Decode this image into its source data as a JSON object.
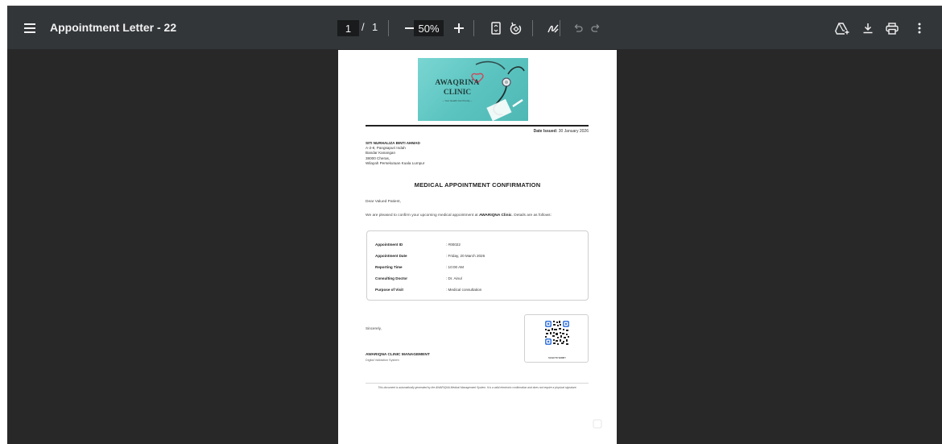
{
  "toolbar": {
    "title": "Appointment Letter - 22",
    "page_current": "1",
    "page_separator": "/",
    "page_total": "1",
    "zoom": "50%",
    "icons": [
      "menu-icon",
      "minus-icon",
      "plus-icon",
      "fit-page-icon",
      "rotate-icon",
      "annotate-icon",
      "undo-icon",
      "redo-icon",
      "drive-icon",
      "download-icon",
      "print-icon",
      "more-vert-icon"
    ]
  },
  "letter": {
    "logo": {
      "name": "AWAQRINA",
      "clinic": "CLINIC",
      "tagline": "~ Your Health Our Priority ~"
    },
    "date_label": "Date Issued:",
    "date_value": "30 January 2026",
    "recipient": {
      "name": "SITI NURHALIZA BINTI AHMAD",
      "line1": "A-2-8, Pangsapuri Indah",
      "line2": "Bandar Kanangan",
      "line3": "38000 Cheras,",
      "line4": "Wilayah Persekutuan Kuala Lumpur"
    },
    "heading": "MEDICAL APPOINTMENT CONFIRMATION",
    "salutation": "Dear Valued Patient,",
    "intro_before": "We are pleased to confirm your upcoming medical appointment at ",
    "intro_clinic": "AWARIQNA Clinic",
    "intro_after": ". Details are as follows:",
    "details": [
      {
        "label": "Appointment ID",
        "value": ": #00022"
      },
      {
        "label": "Appointment Date",
        "value": ": Friday, 20 March 2026"
      },
      {
        "label": "Reporting Time",
        "value": ": 10:00 AM"
      },
      {
        "label": "Consulting Doctor",
        "value": ": Dr. Ainul"
      },
      {
        "label": "Purpose of Visit",
        "value": ": Medical consultation"
      }
    ],
    "closing": "Sincerely,",
    "signatory": "AWARIQNA CLINIC MANAGEMENT",
    "signatory_sub": "Digital Validation System",
    "qr_caption": "SCAN TO VERIFY",
    "footer": "This document is automatically generated by the AWARIQNA Medical Management System. It is a valid electronic confirmation and does not require a physical signature."
  }
}
